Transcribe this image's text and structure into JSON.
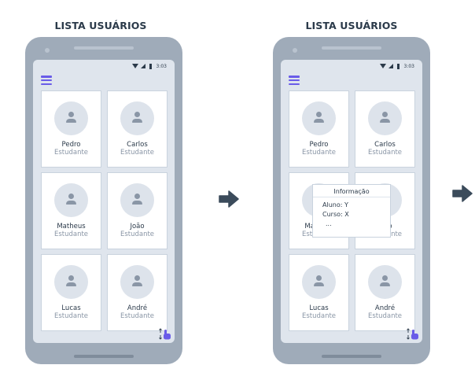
{
  "screens": [
    {
      "title": "LISTA USUÁRIOS",
      "status_time": "3:03",
      "cards": [
        {
          "name": "Pedro",
          "role": "Estudante"
        },
        {
          "name": "Carlos",
          "role": "Estudante"
        },
        {
          "name": "Matheus",
          "role": "Estudante"
        },
        {
          "name": "João",
          "role": "Estudante"
        },
        {
          "name": "Lucas",
          "role": "Estudante"
        },
        {
          "name": "André",
          "role": "Estudante"
        }
      ]
    },
    {
      "title": "LISTA USUÁRIOS",
      "status_time": "3:03",
      "cards": [
        {
          "name": "Pedro",
          "role": "Estudante"
        },
        {
          "name": "Carlos",
          "role": "Estudante"
        },
        {
          "name": "Matheus",
          "role": "Estudante"
        },
        {
          "name": "João",
          "role": "Estudante"
        },
        {
          "name": "Lucas",
          "role": "Estudante"
        },
        {
          "name": "André",
          "role": "Estudante"
        }
      ],
      "popup": {
        "title": "Informação",
        "lines": [
          "Aluno: Y",
          "Curso: X",
          "..."
        ]
      }
    }
  ],
  "icons": {
    "menu": "hamburger-menu-icon",
    "tap": "tap-gesture-icon",
    "flow_arrow": "right-arrow-icon"
  },
  "colors": {
    "phone_body": "#9fabb9",
    "screen_bg": "#dfe5ed",
    "accent": "#6a5ce8",
    "arrow": "#3b4b5b",
    "text_dark": "#2b3a4a",
    "text_muted": "#8a96a6"
  }
}
